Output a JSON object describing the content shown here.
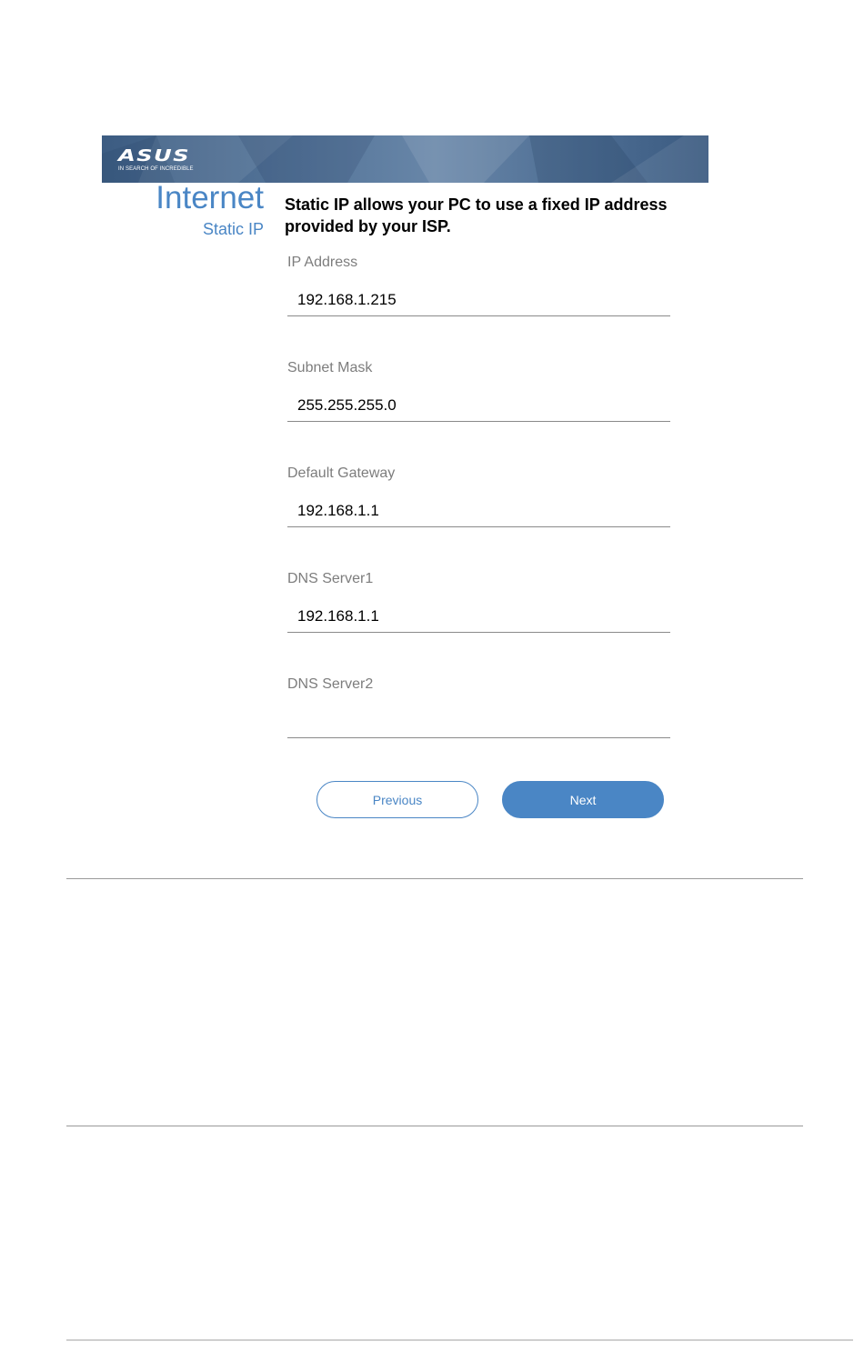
{
  "banner": {
    "brand": "ASUS",
    "tagline": "IN SEARCH OF INCREDIBLE"
  },
  "page": {
    "title": "Internet",
    "subtitle": "Static IP",
    "description": "Static IP allows your PC to use a fixed IP address provided by your ISP."
  },
  "form": {
    "ip_address": {
      "label": "IP Address",
      "value": "192.168.1.215"
    },
    "subnet_mask": {
      "label": "Subnet Mask",
      "value": "255.255.255.0"
    },
    "default_gateway": {
      "label": "Default Gateway",
      "value": "192.168.1.1"
    },
    "dns_server1": {
      "label": "DNS Server1",
      "value": "192.168.1.1"
    },
    "dns_server2": {
      "label": "DNS Server2",
      "value": ""
    }
  },
  "buttons": {
    "previous": "Previous",
    "next": "Next"
  },
  "colors": {
    "accent": "#4a86c5",
    "banner": "#4f6f95",
    "label": "#7d7d7d"
  }
}
